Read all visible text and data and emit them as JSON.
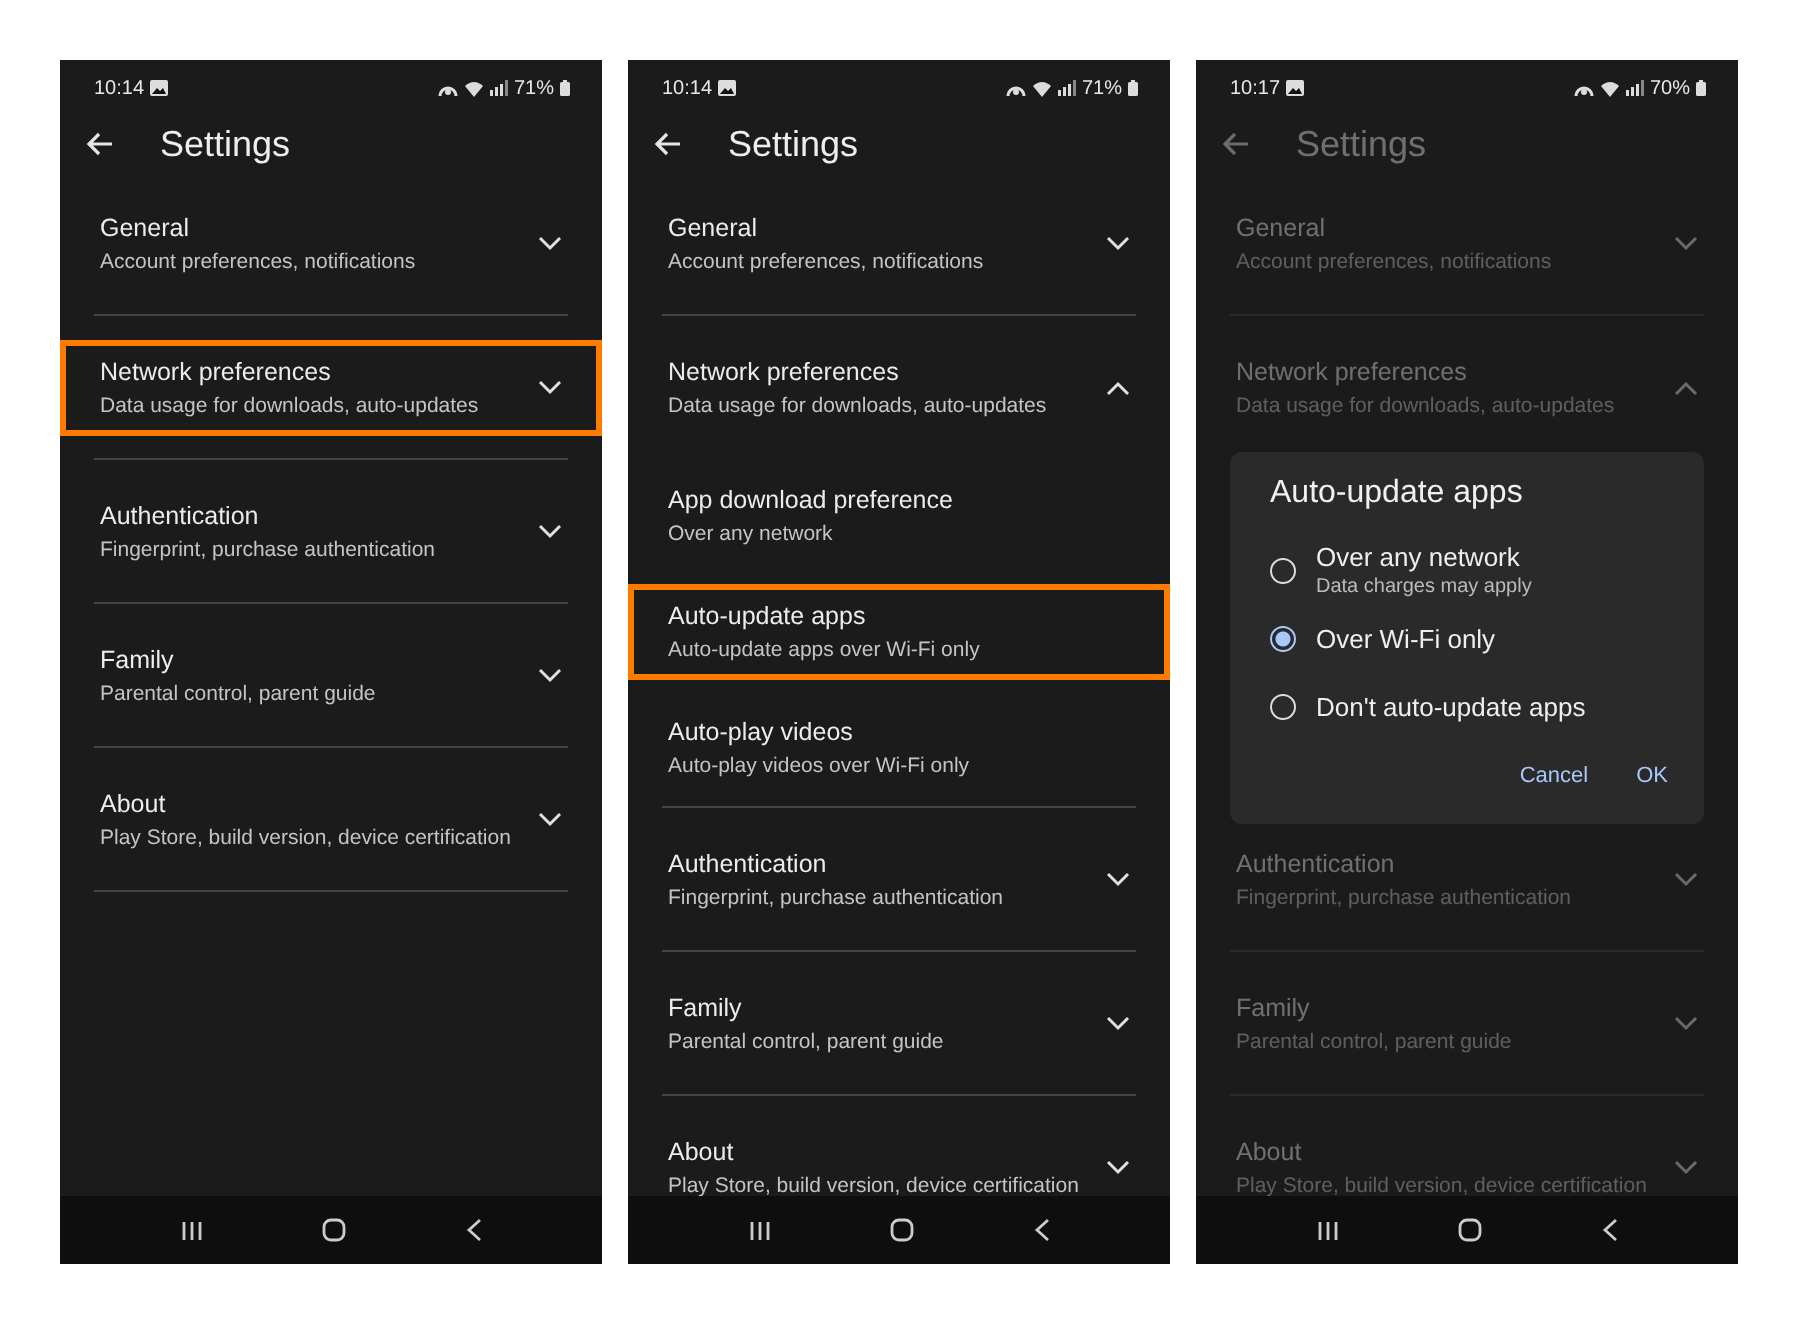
{
  "phones": [
    {
      "time": "10:14",
      "battery": "71%",
      "title": "Settings",
      "dimmed": false,
      "items": [
        {
          "title": "General",
          "subtitle": "Account preferences, notifications",
          "expanded": false,
          "highlighted": false
        },
        {
          "title": "Network preferences",
          "subtitle": "Data usage for downloads, auto-updates",
          "expanded": false,
          "highlighted": true
        },
        {
          "title": "Authentication",
          "subtitle": "Fingerprint, purchase authentication",
          "expanded": false,
          "highlighted": false
        },
        {
          "title": "Family",
          "subtitle": "Parental control, parent guide",
          "expanded": false,
          "highlighted": false
        },
        {
          "title": "About",
          "subtitle": "Play Store, build version, device certification",
          "expanded": false,
          "highlighted": false
        }
      ]
    },
    {
      "time": "10:14",
      "battery": "71%",
      "title": "Settings",
      "dimmed": false,
      "items": [
        {
          "title": "General",
          "subtitle": "Account preferences, notifications",
          "expanded": false,
          "highlighted": false
        },
        {
          "title": "Network preferences",
          "subtitle": "Data usage for downloads, auto-updates",
          "expanded": true,
          "highlighted": false,
          "children": [
            {
              "title": "App download preference",
              "subtitle": "Over any network",
              "highlighted": false
            },
            {
              "title": "Auto-update apps",
              "subtitle": "Auto-update apps over Wi-Fi only",
              "highlighted": true
            },
            {
              "title": "Auto-play videos",
              "subtitle": "Auto-play videos over Wi-Fi only",
              "highlighted": false
            }
          ]
        },
        {
          "title": "Authentication",
          "subtitle": "Fingerprint, purchase authentication",
          "expanded": false,
          "highlighted": false
        },
        {
          "title": "Family",
          "subtitle": "Parental control, parent guide",
          "expanded": false,
          "highlighted": false
        },
        {
          "title": "About",
          "subtitle": "Play Store, build version, device certification",
          "expanded": false,
          "highlighted": false
        }
      ]
    },
    {
      "time": "10:17",
      "battery": "70%",
      "title": "Settings",
      "dimmed": true,
      "items": [
        {
          "title": "General",
          "subtitle": "Account preferences, notifications",
          "expanded": false,
          "highlighted": false
        },
        {
          "title": "Network preferences",
          "subtitle": "Data usage for downloads, auto-updates",
          "expanded": true,
          "highlighted": false
        },
        {
          "title": "Authentication",
          "subtitle": "Fingerprint, purchase authentication",
          "expanded": false,
          "highlighted": false
        },
        {
          "title": "Family",
          "subtitle": "Parental control, parent guide",
          "expanded": false,
          "highlighted": false
        },
        {
          "title": "About",
          "subtitle": "Play Store, build version, device certification",
          "expanded": false,
          "highlighted": false
        }
      ],
      "dialog": {
        "title": "Auto-update apps",
        "options": [
          {
            "label": "Over any network",
            "hint": "Data charges may apply",
            "selected": false
          },
          {
            "label": "Over Wi-Fi only",
            "selected": true
          },
          {
            "label": "Don't auto-update apps",
            "selected": false
          }
        ],
        "buttons": [
          "Cancel",
          "OK"
        ]
      }
    }
  ]
}
